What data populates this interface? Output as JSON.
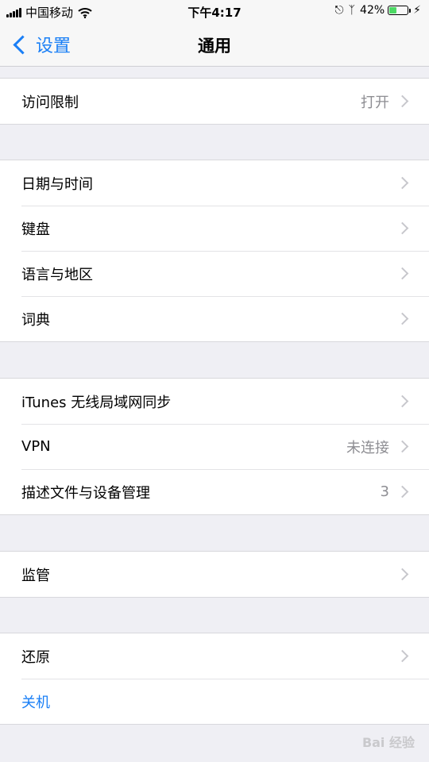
{
  "status_bar": {
    "carrier": "中国移动",
    "time": "下午4:17",
    "battery": "42%",
    "battery_level": 0.42,
    "icons": [
      "signal-icon",
      "wifi-icon",
      "rotation-lock-icon",
      "bluetooth-icon",
      "battery-icon"
    ]
  },
  "nav": {
    "back_label": "设置",
    "title": "通用"
  },
  "groups": [
    {
      "rows": [
        {
          "label": "访问限制",
          "value": "打开"
        }
      ]
    },
    {
      "rows": [
        {
          "label": "日期与时间"
        },
        {
          "label": "键盘"
        },
        {
          "label": "语言与地区"
        },
        {
          "label": "词典"
        }
      ]
    },
    {
      "rows": [
        {
          "label": "iTunes 无线局域网同步"
        },
        {
          "label": "VPN",
          "value": "未连接"
        },
        {
          "label": "描述文件与设备管理",
          "value": "3"
        }
      ]
    },
    {
      "rows": [
        {
          "label": "监管"
        }
      ]
    },
    {
      "rows": [
        {
          "label": "还原"
        },
        {
          "label": "关机"
        }
      ]
    }
  ],
  "watermark": "Bai 经验",
  "colors": {
    "accent": "#1a7ff6",
    "background": "#efeff4",
    "battery": "#4cd964"
  }
}
